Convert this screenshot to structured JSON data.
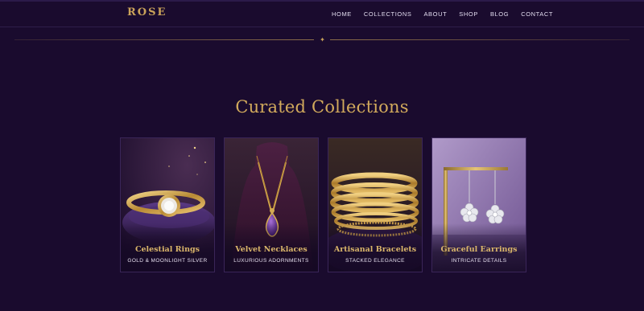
{
  "header": {
    "logo": "ROSE",
    "nav": [
      "HOME",
      "COLLECTIONS",
      "ABOUT",
      "SHOP",
      "BLOG",
      "CONTACT"
    ]
  },
  "divider_glyph": "✦",
  "section": {
    "title": "Curated Collections"
  },
  "cards": [
    {
      "name": "Celestial Rings",
      "subtitle": "GOLD & MOONLIGHT SILVER"
    },
    {
      "name": "Velvet Necklaces",
      "subtitle": "LUXURIOUS ADORNMENTS"
    },
    {
      "name": "Artisanal Bracelets",
      "subtitle": "STACKED ELEGANCE"
    },
    {
      "name": "Graceful Earrings",
      "subtitle": "INTRICATE DETAILS"
    }
  ],
  "colors": {
    "background": "#1a0b2e",
    "gold": "#caa35a",
    "text": "#e2dcef"
  }
}
